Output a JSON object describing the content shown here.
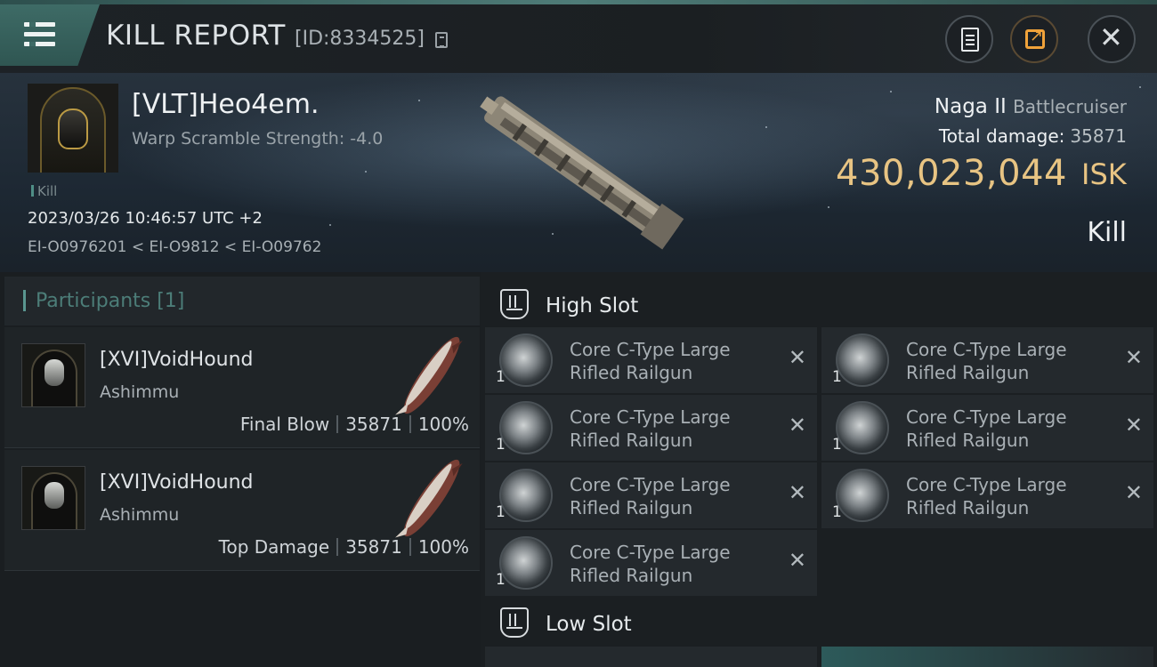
{
  "header": {
    "title": "KILL REPORT",
    "report_id": "[ID:8334525]",
    "icons": {
      "menu": "hamburger-icon",
      "copy": "copy-icon",
      "report": "clipboard-icon",
      "share": "share-icon",
      "close": "close-icon"
    },
    "colors": {
      "accent": "#3e6b66",
      "share_accent": "#f0a23a"
    }
  },
  "victim": {
    "name": "[VLT]Heo4em.",
    "warp_scramble": "Warp Scramble Strength: -4.0",
    "tag": "Kill",
    "datetime": "2023/03/26 10:46:57 UTC +2",
    "systems": "EI-O0976201 < EI-O9812 < EI-O09762",
    "ship": "Naga II",
    "ship_class": "Battlecruiser",
    "total_damage_label": "Total damage:",
    "total_damage": "35871",
    "isk_value": "430,023,044",
    "isk_unit": "ISK",
    "result": "Kill",
    "colors": {
      "isk": "#e8c483"
    }
  },
  "participants": {
    "title": "Participants [1]",
    "rows": [
      {
        "name": "[XVI]VoidHound",
        "ship": "Ashimmu",
        "role": "Final Blow",
        "damage": "35871",
        "percent": "100%"
      },
      {
        "name": "[XVI]VoidHound",
        "ship": "Ashimmu",
        "role": "Top Damage",
        "damage": "35871",
        "percent": "100%"
      }
    ]
  },
  "fitting": {
    "high_slot": {
      "title": "High Slot",
      "modules": [
        {
          "qty": "1",
          "line1": "Core C-Type Large",
          "line2": "Rifled Railgun"
        },
        {
          "qty": "1",
          "line1": "Core C-Type Large",
          "line2": "Rifled Railgun"
        },
        {
          "qty": "1",
          "line1": "Core C-Type Large",
          "line2": "Rifled Railgun"
        },
        {
          "qty": "1",
          "line1": "Core C-Type Large",
          "line2": "Rifled Railgun"
        },
        {
          "qty": "1",
          "line1": "Core C-Type Large",
          "line2": "Rifled Railgun"
        },
        {
          "qty": "1",
          "line1": "Core C-Type Large",
          "line2": "Rifled Railgun"
        },
        {
          "qty": "1",
          "line1": "Core C-Type Large",
          "line2": "Rifled Railgun"
        }
      ]
    },
    "low_slot": {
      "title": "Low Slot"
    },
    "remove_symbol": "✕"
  }
}
